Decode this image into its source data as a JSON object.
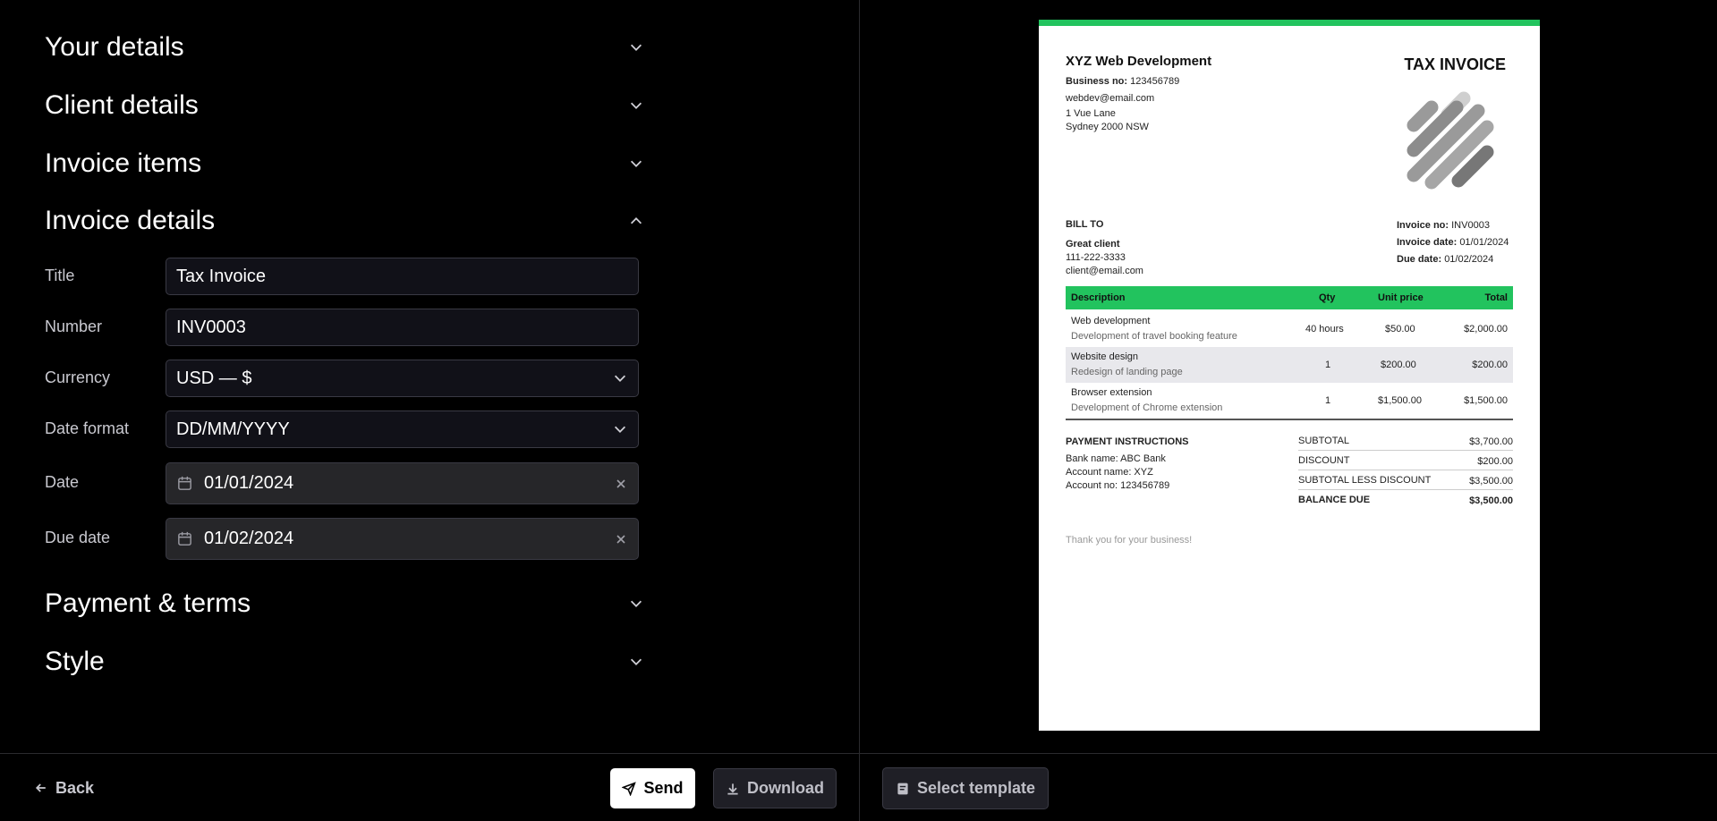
{
  "sections": {
    "your_details": "Your details",
    "client_details": "Client details",
    "invoice_items": "Invoice items",
    "invoice_details": "Invoice details",
    "payment_terms": "Payment & terms",
    "style": "Style"
  },
  "form": {
    "title_label": "Title",
    "title_value": "Tax Invoice",
    "number_label": "Number",
    "number_value": "INV0003",
    "currency_label": "Currency",
    "currency_value": "USD — $",
    "date_format_label": "Date format",
    "date_format_value": "DD/MM/YYYY",
    "date_label": "Date",
    "date_value": "01/01/2024",
    "due_date_label": "Due date",
    "due_date_value": "01/02/2024"
  },
  "footer": {
    "back": "Back",
    "send": "Send",
    "download": "Download",
    "select_template": "Select template"
  },
  "invoice": {
    "accent_color": "#22c35e",
    "business_name": "XYZ Web Development",
    "business_no_label": "Business no:",
    "business_no": "123456789",
    "email": "webdev@email.com",
    "address1": "1 Vue Lane",
    "address2": "Sydney 2000 NSW",
    "title": "TAX INVOICE",
    "bill_to_label": "BILL TO",
    "client_name": "Great client",
    "client_phone": "111-222-3333",
    "client_email": "client@email.com",
    "invoice_no_label": "Invoice no:",
    "invoice_no": "INV0003",
    "invoice_date_label": "Invoice date:",
    "invoice_date": "01/01/2024",
    "due_date_label": "Due date:",
    "due_date": "01/02/2024",
    "columns": {
      "description": "Description",
      "qty": "Qty",
      "unit_price": "Unit price",
      "total": "Total"
    },
    "items": [
      {
        "name": "Web development",
        "desc": "Development of travel booking feature",
        "qty": "40 hours",
        "unit_price": "$50.00",
        "total": "$2,000.00"
      },
      {
        "name": "Website design",
        "desc": "Redesign of landing page",
        "qty": "1",
        "unit_price": "$200.00",
        "total": "$200.00"
      },
      {
        "name": "Browser extension",
        "desc": "Development of Chrome extension",
        "qty": "1",
        "unit_price": "$1,500.00",
        "total": "$1,500.00"
      }
    ],
    "payment_label": "PAYMENT INSTRUCTIONS",
    "bank_name": "Bank name: ABC Bank",
    "account_name": "Account name: XYZ",
    "account_no": "Account no: 123456789",
    "subtotal_label": "SUBTOTAL",
    "subtotal": "$3,700.00",
    "discount_label": "DISCOUNT",
    "discount": "$200.00",
    "subtotal_less_label": "SUBTOTAL LESS DISCOUNT",
    "subtotal_less": "$3,500.00",
    "balance_label": "BALANCE DUE",
    "balance": "$3,500.00",
    "thanks": "Thank you for your business!"
  }
}
